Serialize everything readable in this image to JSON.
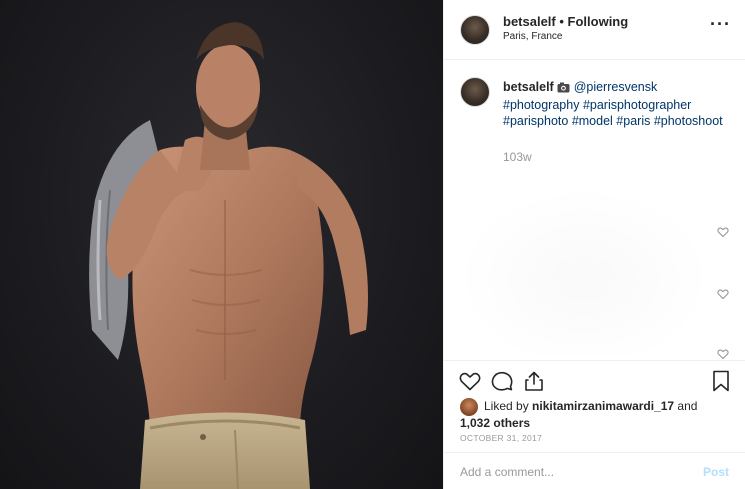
{
  "header": {
    "username": "betsalelf",
    "separator": " • ",
    "follow_status": "Following",
    "location": "Paris, France",
    "more_icon": "more-horizontal-icon"
  },
  "caption": {
    "username": "betsalelf",
    "emoji": "camera-icon",
    "mention": "@pierresvensk",
    "hashtags": [
      "#photography",
      "#parisphotographer",
      "#parisphoto",
      "#model",
      "#paris",
      "#photoshoot"
    ],
    "time": "103w"
  },
  "actions": {
    "icons": [
      "heart-icon",
      "comment-icon",
      "share-icon",
      "bookmark-icon"
    ]
  },
  "likes": {
    "prefix": "Liked by ",
    "user": "nikitamirzanimawardi_17",
    "mid": " and",
    "others": "1,032 others"
  },
  "date": "OCTOBER 31, 2017",
  "comment": {
    "placeholder": "Add a comment...",
    "post_label": "Post"
  },
  "colors": {
    "hashtag": "#003569",
    "post_button_disabled": "#b2dffc",
    "muted": "#999999"
  }
}
